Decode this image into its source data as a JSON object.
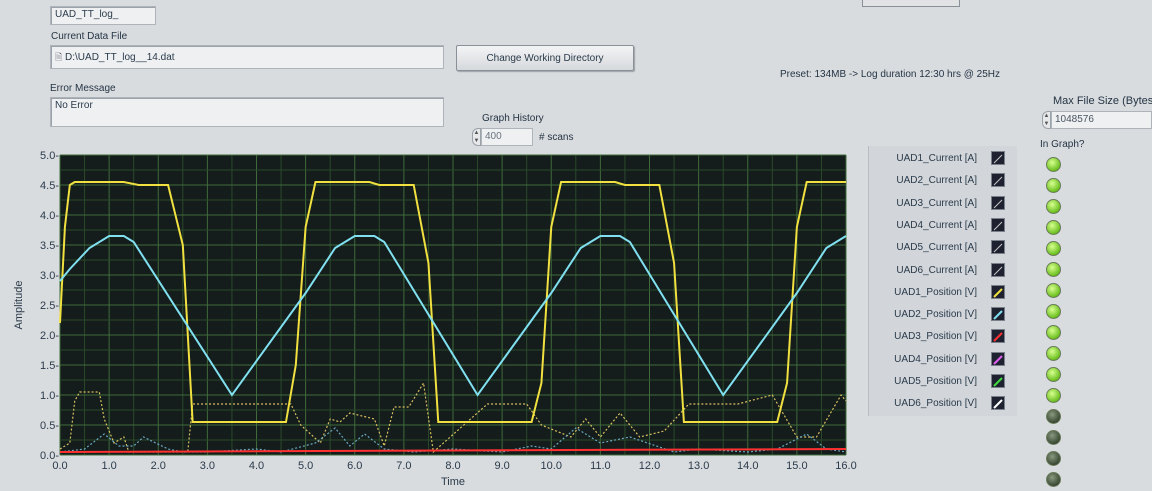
{
  "file_name": {
    "value": "UAD_TT_log_"
  },
  "current_file": {
    "label": "Current Data File",
    "value": "D:\\UAD_TT_log__14.dat"
  },
  "change_dir_button": "Change Working Directory",
  "preset_text": "Preset: 134MB -> Log duration 12:30 hrs  @ 25Hz",
  "error": {
    "label": "Error Message",
    "value": "No Error"
  },
  "graph_history": {
    "label": "Graph History",
    "value": "400",
    "unit": "# scans"
  },
  "max_file_size": {
    "label": "Max File Size (Bytes",
    "value": "1048576"
  },
  "in_graph_label": "In Graph?",
  "legend": [
    {
      "label": "UAD1_Current [A]",
      "color": "#c8c8c8"
    },
    {
      "label": "UAD2_Current [A]",
      "color": "#c8c8c8"
    },
    {
      "label": "UAD3_Current [A]",
      "color": "#c8c8c8"
    },
    {
      "label": "UAD4_Current [A]",
      "color": "#c8c8c8"
    },
    {
      "label": "UAD5_Current [A]",
      "color": "#c8c8c8"
    },
    {
      "label": "UAD6_Current [A]",
      "color": "#c8c8c8"
    },
    {
      "label": "UAD1_Position [V]",
      "color": "#f0e040"
    },
    {
      "label": "UAD2_Position [V]",
      "color": "#80e0f0"
    },
    {
      "label": "UAD3_Position [V]",
      "color": "#ff3030"
    },
    {
      "label": "UAD4_Position [V]",
      "color": "#e060f0"
    },
    {
      "label": "UAD5_Position [V]",
      "color": "#40e040"
    },
    {
      "label": "UAD6_Position [V]",
      "color": "#ffffff"
    }
  ],
  "leds": [
    "on",
    "on",
    "on",
    "on",
    "on",
    "on",
    "on",
    "on",
    "on",
    "on",
    "on",
    "on",
    "off",
    "off",
    "off",
    "off"
  ],
  "chart_data": {
    "type": "line",
    "xlabel": "Time",
    "ylabel": "Amplitude",
    "xlim": [
      0,
      16
    ],
    "ylim": [
      0,
      5
    ],
    "xticks": [
      "0.0",
      "1.0",
      "2.0",
      "3.0",
      "4.0",
      "5.0",
      "6.0",
      "7.0",
      "8.0",
      "9.0",
      "10.0",
      "11.0",
      "12.0",
      "13.0",
      "14.0",
      "15.0",
      "16.0"
    ],
    "yticks": [
      "0.0-",
      "0.5-",
      "1.0-",
      "1.5-",
      "2.0-",
      "2.5-",
      "3.0-",
      "3.5-",
      "4.0-",
      "4.5-",
      "5.0-"
    ],
    "grid": true,
    "series": [
      {
        "name": "UAD1_Position [V]",
        "color": "#f0e040",
        "x": [
          0.0,
          0.1,
          0.2,
          0.3,
          0.4,
          1.3,
          1.6,
          2.2,
          2.5,
          2.7,
          4.6,
          4.8,
          5.0,
          5.2,
          6.3,
          6.5,
          7.2,
          7.5,
          7.7,
          9.6,
          9.8,
          10.0,
          10.2,
          11.3,
          11.5,
          12.2,
          12.5,
          12.7,
          14.6,
          14.8,
          15.0,
          15.2,
          16.0
        ],
        "y": [
          2.2,
          3.8,
          4.5,
          4.55,
          4.55,
          4.55,
          4.5,
          4.5,
          3.5,
          0.55,
          0.55,
          1.5,
          3.8,
          4.55,
          4.55,
          4.5,
          4.5,
          3.2,
          0.55,
          0.55,
          1.2,
          3.8,
          4.55,
          4.55,
          4.5,
          4.5,
          3.2,
          0.55,
          0.55,
          1.2,
          3.8,
          4.55,
          4.55
        ]
      },
      {
        "name": "UAD2_Position [V]",
        "color": "#80e0f0",
        "x": [
          0.0,
          0.2,
          0.6,
          1.0,
          1.3,
          1.5,
          3.5,
          5.0,
          5.6,
          6.0,
          6.4,
          6.6,
          8.5,
          10.0,
          10.6,
          11.0,
          11.4,
          11.6,
          13.5,
          15.0,
          15.6,
          16.0
        ],
        "y": [
          2.9,
          3.1,
          3.45,
          3.65,
          3.65,
          3.55,
          1.0,
          2.7,
          3.45,
          3.65,
          3.65,
          3.55,
          1.0,
          2.7,
          3.45,
          3.65,
          3.65,
          3.55,
          1.0,
          2.7,
          3.45,
          3.65
        ]
      },
      {
        "name": "UAD3_Position [V]",
        "color": "#ff3030",
        "x": [
          0.0,
          16.0
        ],
        "y": [
          0.05,
          0.1
        ]
      }
    ],
    "dotted_series": [
      {
        "color": "#d8c060",
        "x": [
          0.0,
          0.2,
          0.3,
          0.4,
          0.8,
          0.9,
          1.1,
          1.3,
          1.4,
          2.6,
          2.7,
          3.8,
          4.7,
          4.9,
          5.3,
          5.5,
          5.7,
          5.9,
          6.4,
          6.6,
          6.8,
          7.1,
          7.4,
          7.6,
          8.7,
          9.5,
          9.8,
          10.4,
          10.7,
          11.0,
          11.4,
          11.8,
          12.3,
          12.8,
          13.8,
          14.5,
          15.0,
          15.4,
          15.9,
          16.0
        ],
        "y": [
          0.1,
          0.2,
          0.9,
          1.05,
          1.05,
          0.6,
          0.2,
          0.3,
          0.05,
          0.05,
          0.85,
          0.85,
          0.85,
          0.5,
          0.2,
          0.6,
          0.55,
          0.7,
          0.6,
          0.15,
          0.8,
          0.8,
          1.2,
          0.05,
          0.85,
          0.85,
          0.5,
          0.3,
          0.6,
          0.3,
          0.7,
          0.3,
          0.4,
          0.85,
          0.85,
          1.0,
          0.3,
          0.3,
          1.0,
          0.9
        ]
      },
      {
        "color": "#6aa8c0",
        "x": [
          0.0,
          0.5,
          0.9,
          1.2,
          1.5,
          1.7,
          2.2,
          2.5,
          3.0,
          4.0,
          4.5,
          5.2,
          5.6,
          5.9,
          6.2,
          6.6,
          7.2,
          8.0,
          9.0,
          9.6,
          10.0,
          10.5,
          11.0,
          11.6,
          12.5,
          13.0,
          14.0,
          14.6,
          15.2,
          15.6,
          16.0
        ],
        "y": [
          0.05,
          0.1,
          0.35,
          0.15,
          0.15,
          0.3,
          0.1,
          0.05,
          0.05,
          0.1,
          0.05,
          0.2,
          0.45,
          0.15,
          0.35,
          0.1,
          0.05,
          0.1,
          0.05,
          0.15,
          0.1,
          0.45,
          0.2,
          0.3,
          0.05,
          0.1,
          0.05,
          0.1,
          0.35,
          0.1,
          0.05
        ]
      }
    ]
  }
}
